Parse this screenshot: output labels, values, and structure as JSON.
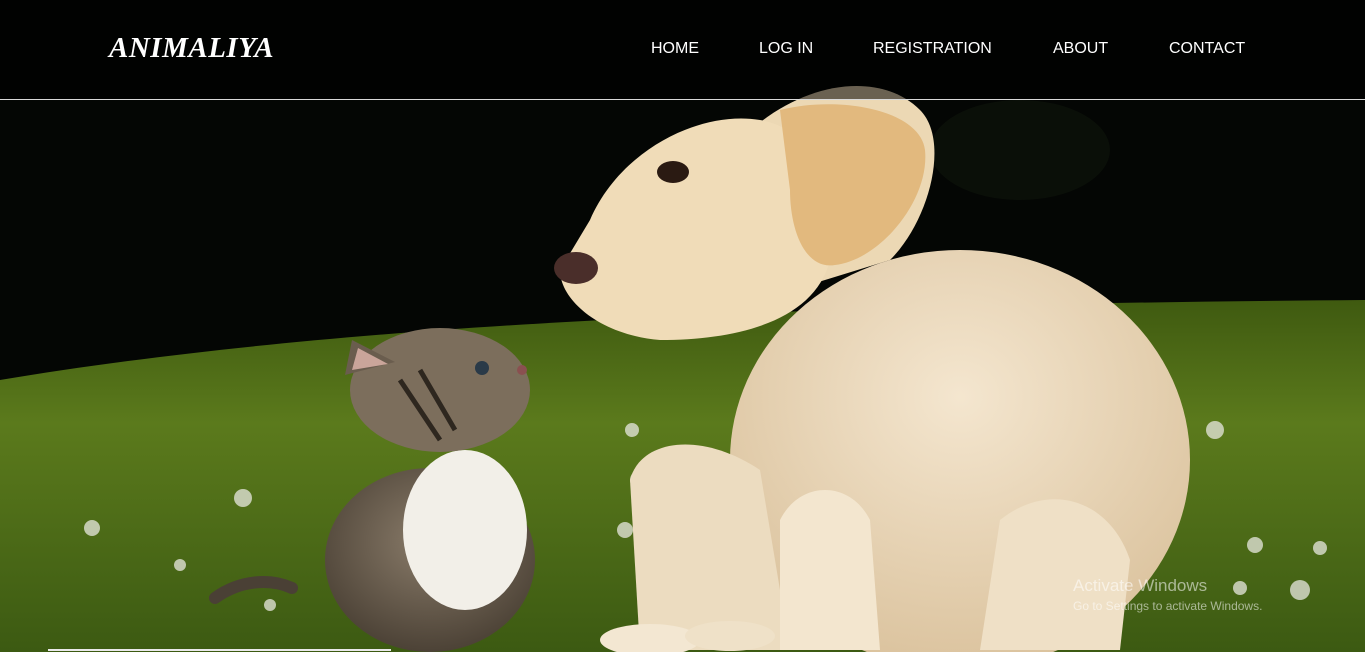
{
  "brand": {
    "name": "ANIMALIYA"
  },
  "nav": {
    "items": [
      {
        "label": "HOME"
      },
      {
        "label": "LOG IN"
      },
      {
        "label": "REGISTRATION"
      },
      {
        "label": "ABOUT"
      },
      {
        "label": "CONTACT"
      }
    ]
  },
  "hero": {
    "image": "puppy-and-kitten-photo"
  },
  "watermark": {
    "line1": "Activate Windows",
    "line2": "Go to Settings to activate Windows."
  }
}
